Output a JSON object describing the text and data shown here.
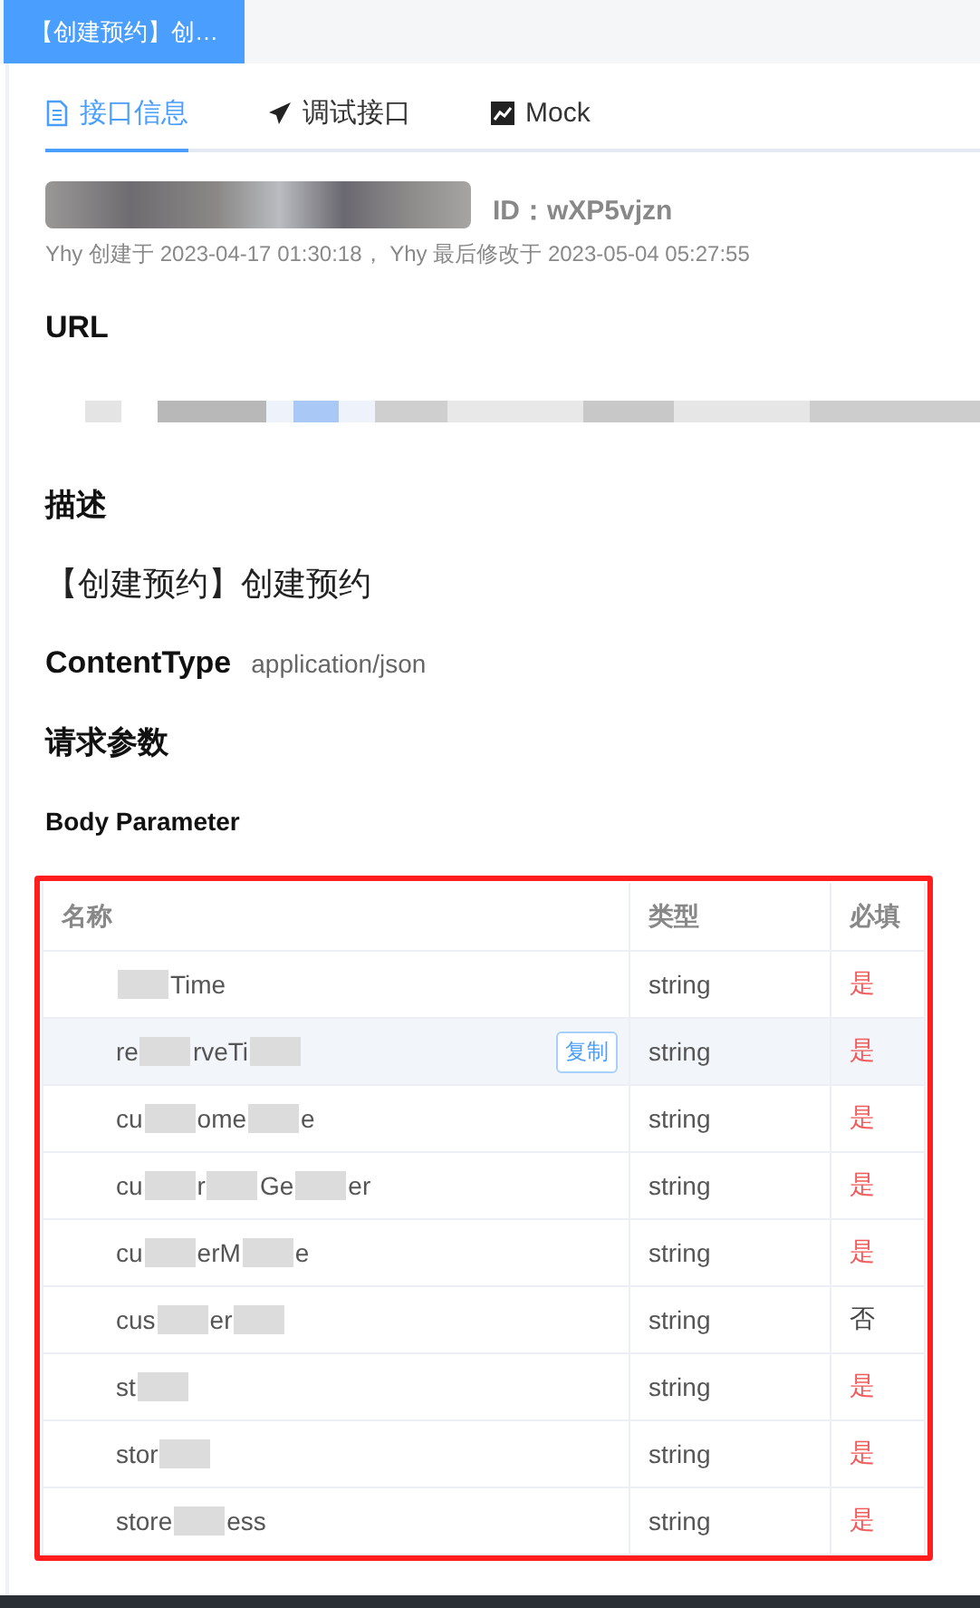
{
  "doc_tab": {
    "label": "【创建预约】创…",
    "selected": true
  },
  "tabs": [
    {
      "label": "接口信息",
      "selected": true
    },
    {
      "label": "调试接口",
      "selected": false
    },
    {
      "label": "Mock",
      "selected": false
    }
  ],
  "title": {
    "id_label": "ID：wXP5vjzn"
  },
  "meta": "Yhy 创建于 2023-04-17 01:30:18， Yhy 最后修改于 2023-05-04 05:27:55",
  "url_heading": "URL",
  "desc_heading": "描述",
  "description": "【创建预约】创建预约",
  "content_type": {
    "label": "ContentType",
    "value": "application/json"
  },
  "params_heading": "请求参数",
  "body_heading": "Body Parameter",
  "table": {
    "columns": [
      "名称",
      "类型",
      "必填"
    ],
    "rows": [
      {
        "name": [
          {
            "kind": "hidden"
          },
          {
            "kind": "text",
            "text": "Time"
          }
        ],
        "type": "string",
        "required": {
          "text": "是",
          "on": true
        },
        "highlighted": false
      },
      {
        "name": [
          {
            "kind": "text",
            "text": "re"
          },
          {
            "kind": "hidden"
          },
          {
            "kind": "text",
            "text": "rveTi"
          },
          {
            "kind": "hidden"
          }
        ],
        "type": "string",
        "required": {
          "text": "是",
          "on": true
        },
        "highlighted": true,
        "copy": "复制"
      },
      {
        "name": [
          {
            "kind": "text",
            "text": "cu"
          },
          {
            "kind": "hidden"
          },
          {
            "kind": "text",
            "text": "ome"
          },
          {
            "kind": "hidden"
          },
          {
            "kind": "text",
            "text": "e"
          }
        ],
        "type": "string",
        "required": {
          "text": "是",
          "on": true
        },
        "highlighted": false
      },
      {
        "name": [
          {
            "kind": "text",
            "text": "cu"
          },
          {
            "kind": "hidden"
          },
          {
            "kind": "text",
            "text": "r"
          },
          {
            "kind": "hidden"
          },
          {
            "kind": "text",
            "text": "Ge"
          },
          {
            "kind": "hidden"
          },
          {
            "kind": "text",
            "text": "er"
          }
        ],
        "type": "string",
        "required": {
          "text": "是",
          "on": true
        },
        "highlighted": false
      },
      {
        "name": [
          {
            "kind": "text",
            "text": "cu"
          },
          {
            "kind": "hidden"
          },
          {
            "kind": "text",
            "text": "erM"
          },
          {
            "kind": "hidden"
          },
          {
            "kind": "text",
            "text": "e"
          }
        ],
        "type": "string",
        "required": {
          "text": "是",
          "on": true
        },
        "highlighted": false
      },
      {
        "name": [
          {
            "kind": "text",
            "text": "cus"
          },
          {
            "kind": "hidden"
          },
          {
            "kind": "text",
            "text": "er"
          },
          {
            "kind": "hidden"
          }
        ],
        "type": "string",
        "required": {
          "text": "否",
          "on": false
        },
        "highlighted": false
      },
      {
        "name": [
          {
            "kind": "text",
            "text": "st"
          },
          {
            "kind": "hidden"
          }
        ],
        "type": "string",
        "required": {
          "text": "是",
          "on": true
        },
        "highlighted": false
      },
      {
        "name": [
          {
            "kind": "text",
            "text": "stor"
          },
          {
            "kind": "hidden"
          }
        ],
        "type": "string",
        "required": {
          "text": "是",
          "on": true
        },
        "highlighted": false
      },
      {
        "name": [
          {
            "kind": "text",
            "text": "store"
          },
          {
            "kind": "hidden"
          },
          {
            "kind": "text",
            "text": "ess"
          }
        ],
        "type": "string",
        "required": {
          "text": "是",
          "on": true
        },
        "highlighted": false
      }
    ]
  }
}
